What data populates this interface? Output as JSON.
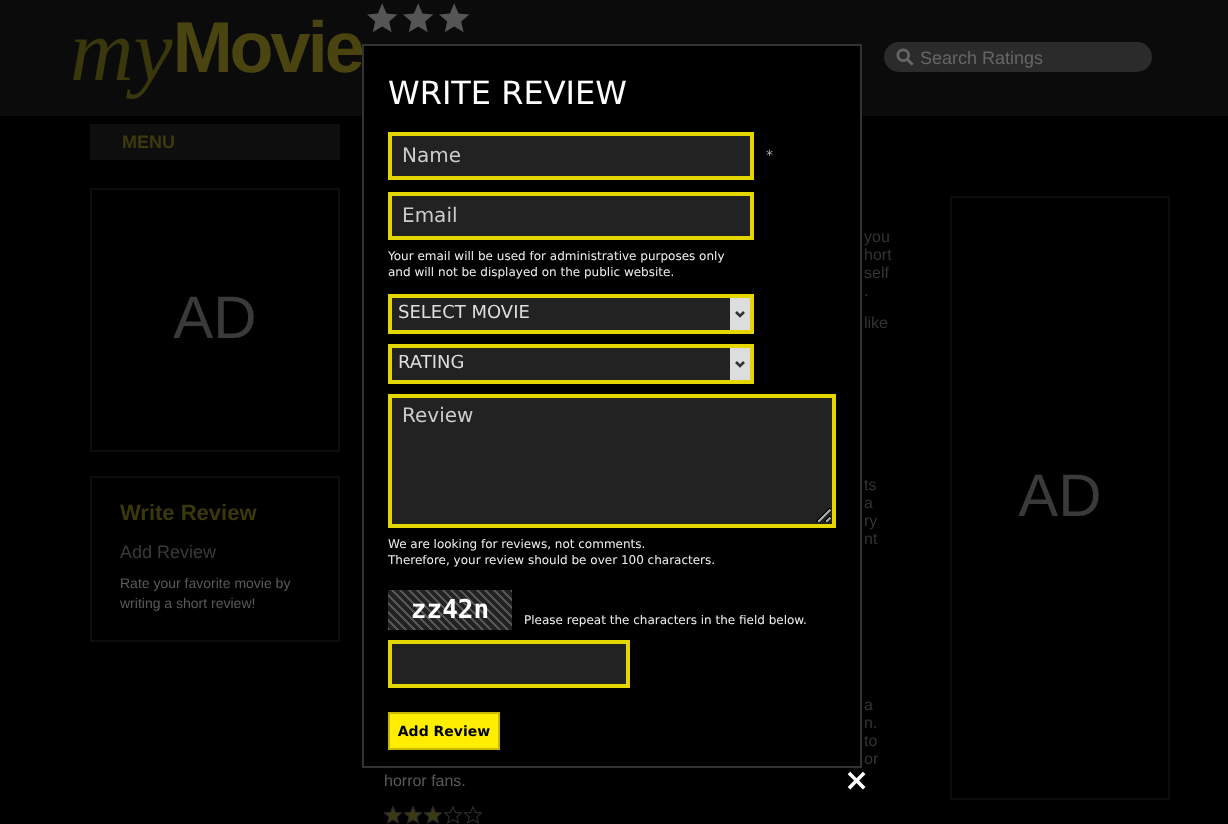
{
  "header": {
    "logo_script": "my",
    "logo_bold": "Movie",
    "search": {
      "placeholder": "Search Ratings"
    }
  },
  "sidebar": {
    "menu_title": "MENU",
    "ad_label": "AD",
    "promo": {
      "title": "Write Review",
      "subtitle": "Add Review",
      "text": "Rate your favorite movie by writing a short review!"
    }
  },
  "middle_fragments": [
    [
      "you",
      "hort",
      "self",
      "."
    ],
    [
      "like"
    ],
    [
      "ts",
      "a",
      "ry",
      "nt"
    ],
    [
      "a",
      "n.",
      "to",
      "or"
    ]
  ],
  "middle_bottom": {
    "text": "horror fans.",
    "stars": 3
  },
  "right_ad_label": "AD",
  "modal": {
    "title": "WRITE REVIEW",
    "name_field": {
      "placeholder": "Name",
      "required_mark": "*"
    },
    "email_field": {
      "placeholder": "Email"
    },
    "email_note": [
      "Your email will be used for administrative purposes only",
      "and will not be displayed on the public website."
    ],
    "movie_select": {
      "value": "SELECT MOVIE"
    },
    "rating_select": {
      "value": "RATING"
    },
    "review_field": {
      "placeholder": "Review"
    },
    "review_note": [
      "We are looking for reviews, not comments.",
      "Therefore, your review should be over 100 characters."
    ],
    "captcha_text": "zz42n",
    "captcha_note": "Please repeat the characters in the field below.",
    "submit_label": "Add Review",
    "close_label": "×"
  }
}
